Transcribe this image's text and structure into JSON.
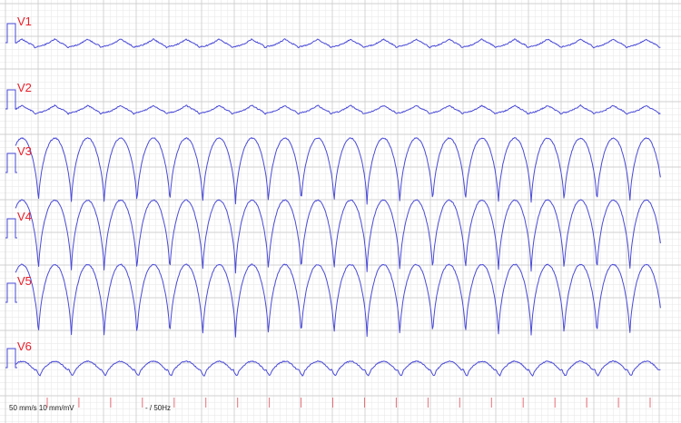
{
  "chart_data": {
    "type": "line",
    "leads": [
      {
        "name": "V1",
        "amplitude": 0.2,
        "shape": "low"
      },
      {
        "name": "V2",
        "amplitude": 0.2,
        "shape": "low"
      },
      {
        "name": "V3",
        "amplitude": 1.0,
        "shape": "wide"
      },
      {
        "name": "V4",
        "amplitude": 1.1,
        "shape": "wide"
      },
      {
        "name": "V5",
        "amplitude": 1.1,
        "shape": "wide"
      },
      {
        "name": "V6",
        "amplitude": 0.35,
        "shape": "notched"
      }
    ],
    "beat_count": 20,
    "footer": {
      "speed_gain": "50 mm/s 10 mm/mV",
      "filter": "- / 50Hz"
    },
    "colors": {
      "trace": "#4a4ad8",
      "grid_minor": "#e6e6e6",
      "grid_major": "#c4c4c4",
      "label": "#e8202a",
      "beat_marker": "#e8707a"
    },
    "grid": true
  }
}
